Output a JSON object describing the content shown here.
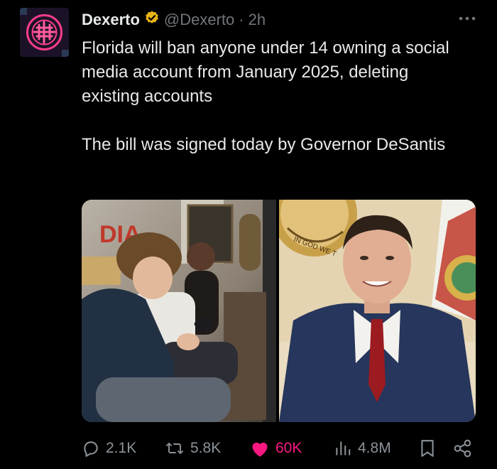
{
  "post": {
    "author_name": "Dexerto",
    "handle": "@Dexerto",
    "separator": "·",
    "time": "2h",
    "text_paragraphs": [
      "Florida will ban anyone under 14 owning a social media account from January 2025, deleting existing accounts",
      "The bill was signed today by Governor DeSantis"
    ]
  },
  "icons": {
    "avatar": "dexerto-logo",
    "verified": "verified-gold-badge-icon",
    "more": "more-options-icon",
    "reply": "reply-icon",
    "repost": "repost-icon",
    "like": "heart-icon",
    "views": "views-icon",
    "bookmark": "bookmark-icon",
    "share": "share-icon"
  },
  "media": {
    "left_image": "teenagers-using-phone",
    "right_image": "governor-desantis-portrait"
  },
  "actions": {
    "replies": "2.1K",
    "reposts": "5.8K",
    "likes": "60K",
    "views": "4.8M"
  },
  "colors": {
    "background": "#000000",
    "text": "#e7e9ea",
    "muted": "#71767b",
    "like_active": "#f91880",
    "verified": "#e8b418"
  }
}
